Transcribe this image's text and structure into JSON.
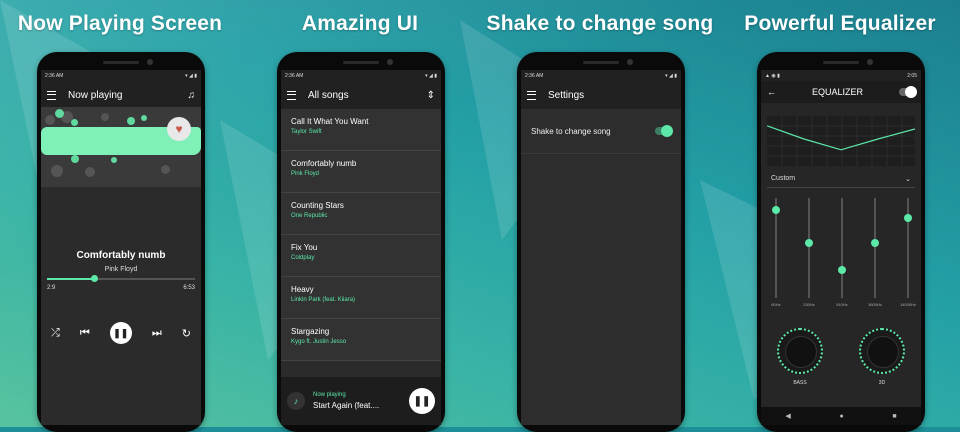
{
  "panels": [
    {
      "title": "Now Playing Screen"
    },
    {
      "title": "Amazing UI"
    },
    {
      "title": "Shake to change song"
    },
    {
      "title": "Powerful Equalizer"
    }
  ],
  "status_time": "2:36 AM",
  "status_time_eq": "2:05",
  "now_playing": {
    "appbar_title": "Now playing",
    "song_title": "Comfortably numb",
    "artist": "Pink Floyd",
    "elapsed": "2:9",
    "duration": "6:53",
    "progress": 0.32,
    "icons": {
      "menu": "menu-icon",
      "queue": "queue-music-icon",
      "heart": "heart-icon",
      "shuffle": "shuffle-icon",
      "prev": "skip-previous-icon",
      "pause": "pause-icon",
      "next": "skip-next-icon",
      "repeat": "repeat-icon"
    }
  },
  "all_songs": {
    "appbar_title": "All songs",
    "songs": [
      {
        "title": "Call It What You Want",
        "artist": "Taylor Swift"
      },
      {
        "title": "Comfortably numb",
        "artist": "Pink Floyd"
      },
      {
        "title": "Counting Stars",
        "artist": "One Republic"
      },
      {
        "title": "Fix You",
        "artist": "Coldplay"
      },
      {
        "title": "Heavy",
        "artist": "Linkin Park (feat. Kiiara)"
      },
      {
        "title": "Stargazing",
        "artist": "Kygo ft. Justin Jesso"
      }
    ],
    "mini_player": {
      "label": "Now playing",
      "song": "Start Again (feat...."
    }
  },
  "settings": {
    "appbar_title": "Settings",
    "shake_label": "Shake to change song",
    "shake_enabled": true
  },
  "equalizer": {
    "title": "EQUALIZER",
    "preset": "Custom",
    "bands": [
      {
        "hz": "60Hz",
        "level": 0.12
      },
      {
        "hz": "230Hz",
        "level": 0.45
      },
      {
        "hz": "910Hz",
        "level": 0.72
      },
      {
        "hz": "3600Hz",
        "level": 0.45
      },
      {
        "hz": "14000Hz",
        "level": 0.2
      }
    ],
    "knobs": [
      {
        "label": "BASS"
      },
      {
        "label": "3D"
      }
    ],
    "accent": "#5be8a8"
  }
}
